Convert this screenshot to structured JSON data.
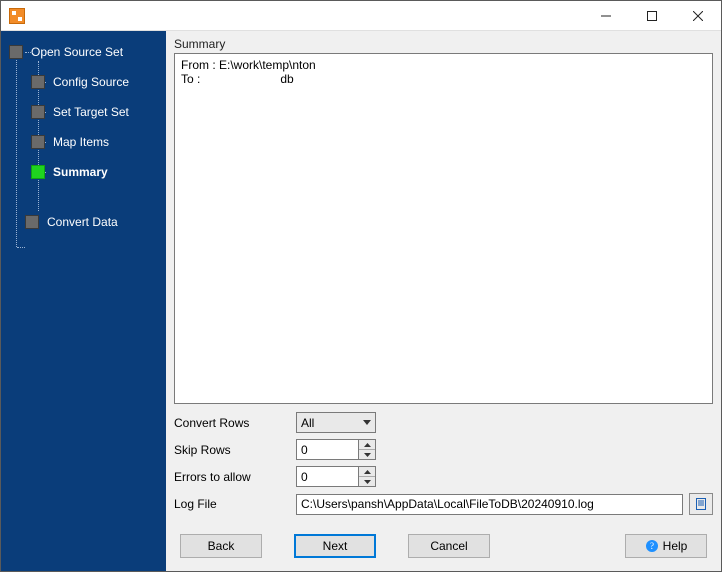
{
  "window": {
    "title": ""
  },
  "sidebar": {
    "items": [
      {
        "label": "Open Source Set"
      },
      {
        "label": "Config Source"
      },
      {
        "label": "Set Target Set"
      },
      {
        "label": "Map Items"
      },
      {
        "label": "Summary"
      },
      {
        "label": "Convert Data"
      }
    ]
  },
  "main": {
    "summary_label": "Summary",
    "summary_text": "From : E:\\work\\temp\\nton\nTo :                        db",
    "rows": {
      "convert_rows_label": "Convert Rows",
      "convert_rows_value": "All",
      "skip_rows_label": "Skip Rows",
      "skip_rows_value": "0",
      "errors_label": "Errors to allow",
      "errors_value": "0",
      "logfile_label": "Log File",
      "logfile_value": "C:\\Users\\pansh\\AppData\\Local\\FileToDB\\20240910.log"
    }
  },
  "buttons": {
    "back": "Back",
    "next": "Next",
    "cancel": "Cancel",
    "help": "Help"
  }
}
